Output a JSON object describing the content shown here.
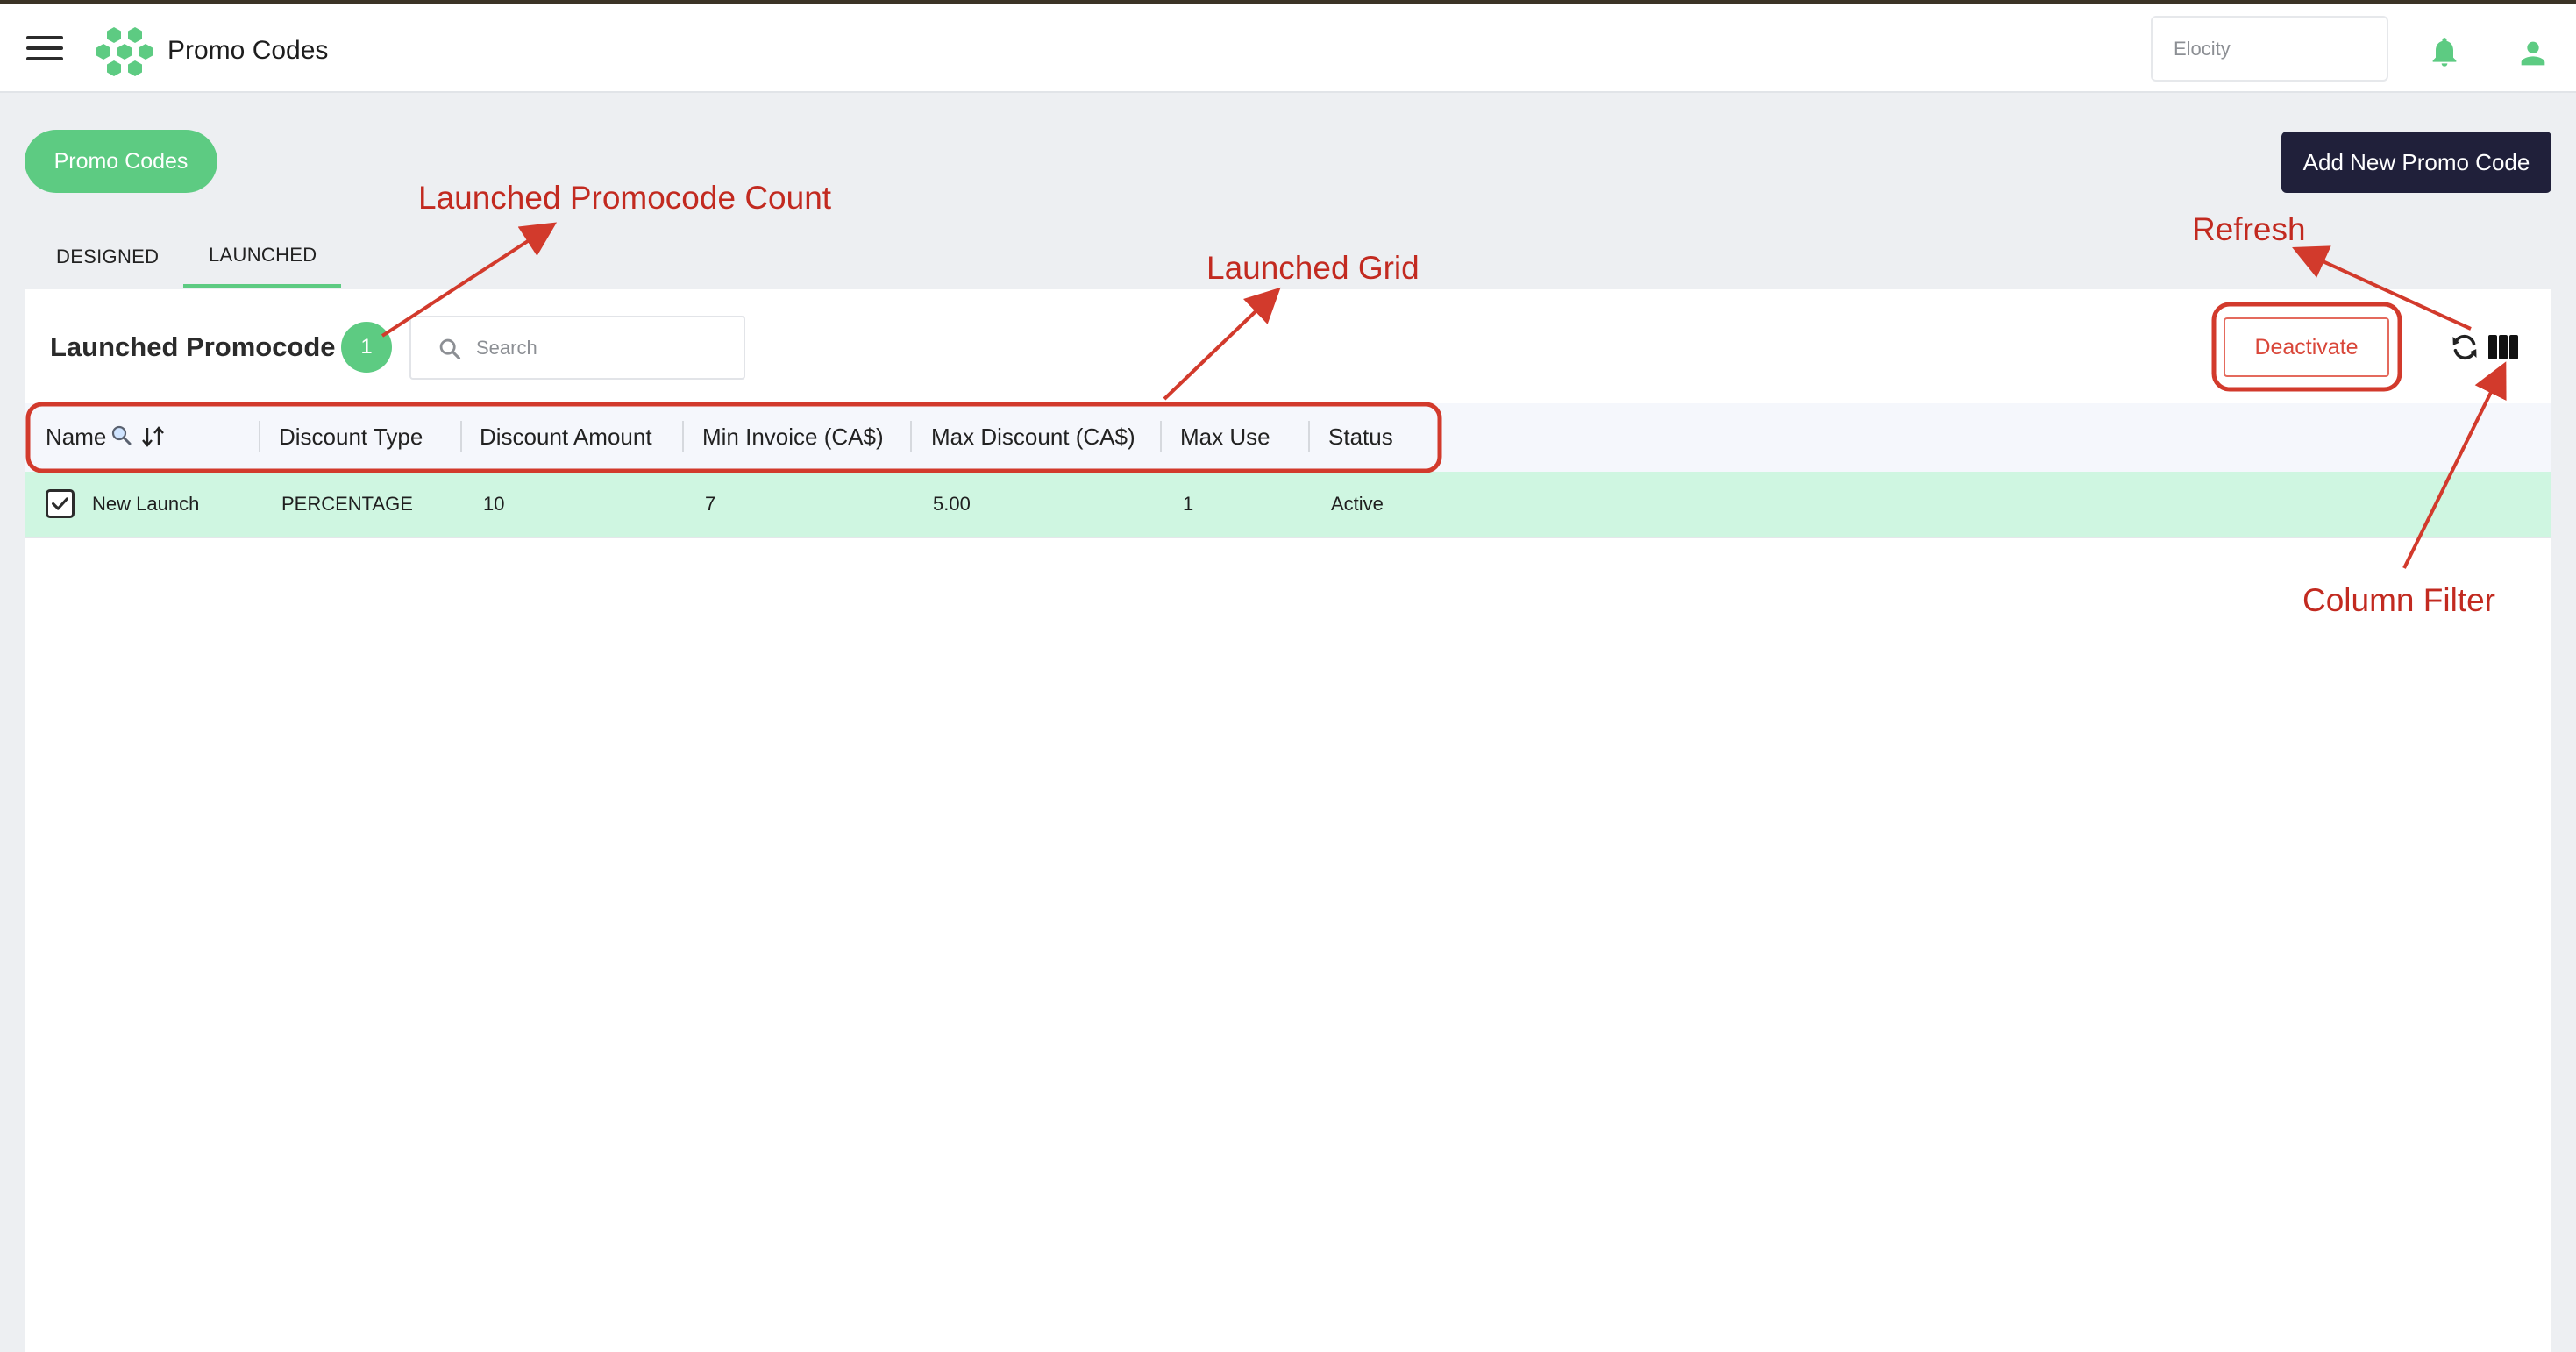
{
  "header": {
    "app_title": "Promo Codes",
    "tenant_placeholder": "Elocity",
    "menu_icon": "hamburger-menu-icon",
    "logo": "hexagon-cluster-logo",
    "notification_icon": "bell-icon",
    "account_icon": "user-icon"
  },
  "page": {
    "breadcrumb_pill": "Promo Codes",
    "add_button": "Add New Promo Code"
  },
  "tabs": [
    {
      "label": "DESIGNED",
      "active": false
    },
    {
      "label": "LAUNCHED",
      "active": true
    }
  ],
  "grid": {
    "title": "Launched Promocode",
    "count": "1",
    "search_placeholder": "Search",
    "deactivate_label": "Deactivate",
    "columns": [
      "Name",
      "Discount Type",
      "Discount Amount",
      "Min Invoice (CA$)",
      "Max Discount (CA$)",
      "Max Use",
      "Status"
    ],
    "rows": [
      {
        "checked": true,
        "cells": [
          "New Launch",
          "PERCENTAGE",
          "10",
          "7",
          "5.00",
          "1",
          "Active"
        ]
      }
    ]
  },
  "annotations": {
    "count_label": "Launched Promocode Count",
    "grid_label": "Launched Grid",
    "refresh_label": "Refresh",
    "column_filter_label": "Column Filter"
  },
  "colors": {
    "accent_green": "#5dcb82",
    "row_selected": "#cff6e1",
    "primary_dark": "#20203a",
    "deactivate_red": "#d9473a",
    "annotation_red": "#c22a20"
  }
}
